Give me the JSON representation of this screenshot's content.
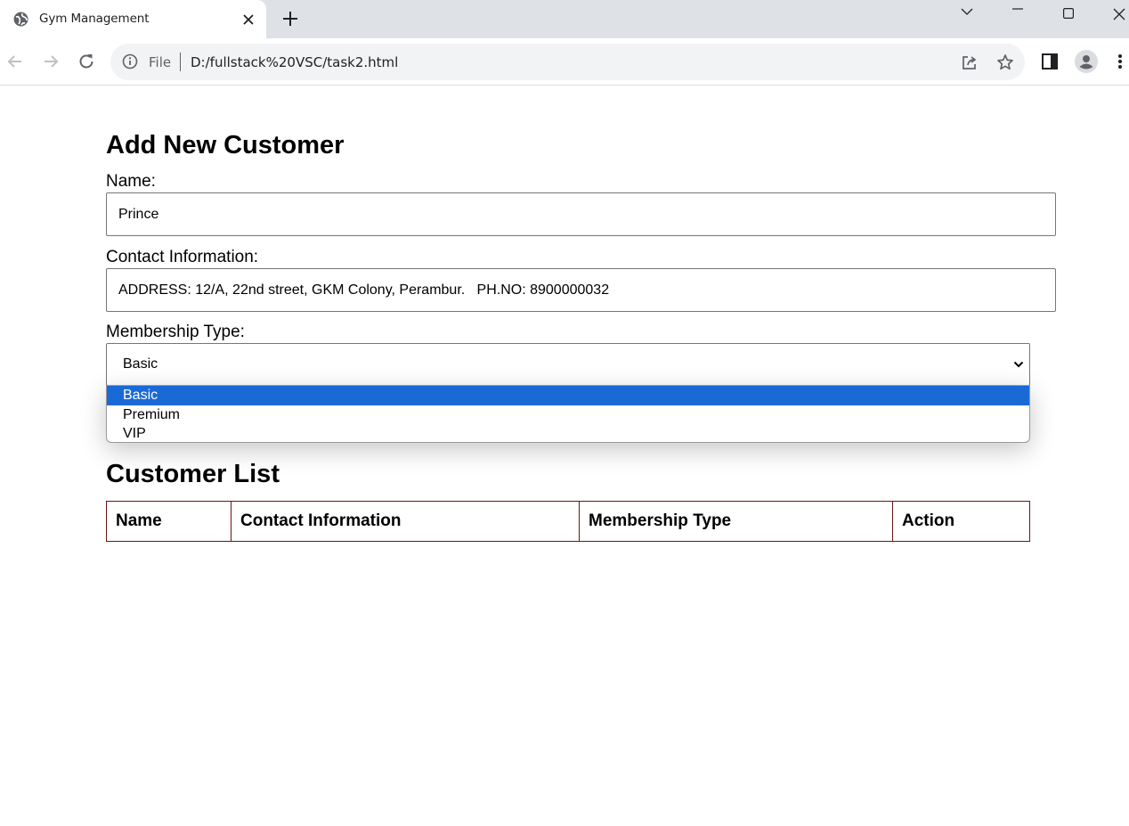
{
  "browser": {
    "tab_title": "Gym Management",
    "url_scheme": "File",
    "url": "D:/fullstack%20VSC/task2.html"
  },
  "form": {
    "title": "Add New Customer",
    "name_label": "Name:",
    "name_value": "Prince",
    "contact_label": "Contact Information:",
    "contact_value": "ADDRESS: 12/A, 22nd street, GKM Colony, Perambur.   PH.NO: 8900000032",
    "membership_label": "Membership Type:",
    "membership_value": "Basic",
    "membership_options": [
      "Basic",
      "Premium",
      "VIP"
    ],
    "membership_selected_index": 0
  },
  "customer_list": {
    "title": "Customer List",
    "columns": [
      "Name",
      "Contact Information",
      "Membership Type",
      "Action"
    ]
  },
  "colors": {
    "selected_option": "#1a6ad6",
    "table_border": "#6b1414",
    "tabstrip": "#dee1e6"
  }
}
